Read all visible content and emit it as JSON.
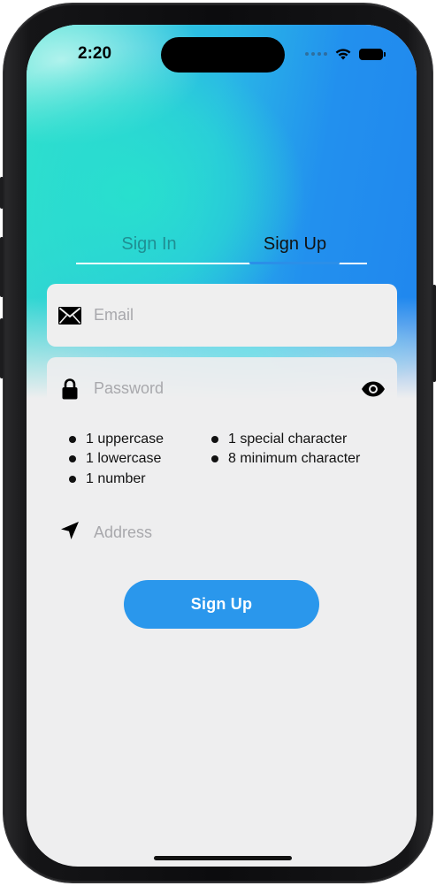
{
  "status_bar": {
    "time": "2:20"
  },
  "tabs": {
    "sign_in": "Sign In",
    "sign_up": "Sign Up",
    "active": "Sign Up"
  },
  "form": {
    "email": {
      "value": "",
      "placeholder": "Email",
      "icon": "envelope-icon"
    },
    "password": {
      "value": "",
      "placeholder": "Password",
      "icon": "lock-icon",
      "toggle_icon": "eye-icon"
    },
    "password_rules": {
      "left": [
        "1 uppercase",
        "1 lowercase",
        "1 number"
      ],
      "right": [
        "1 special character",
        "8 minimum character"
      ]
    },
    "address": {
      "value": "",
      "placeholder": "Address",
      "icon": "location-arrow-icon"
    },
    "submit_label": "Sign Up"
  },
  "colors": {
    "accent": "#2a97ec",
    "inactive_tab": "#1f8f93",
    "gradient_start": "#33e0cc",
    "gradient_end": "#2086ee",
    "background": "#eeeeef"
  }
}
